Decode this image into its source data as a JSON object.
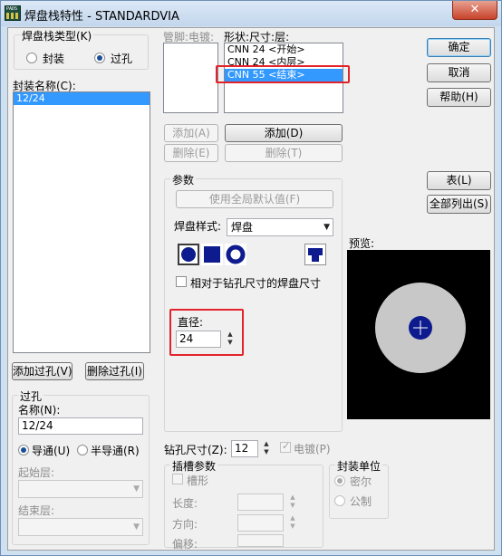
{
  "window": {
    "title": "焊盘栈特性 - STANDARDVIA",
    "close_glyph": "✕"
  },
  "padstack_type": {
    "label": "焊盘栈类型(K)",
    "options": [
      "封装",
      "过孔"
    ],
    "selected": "过孔"
  },
  "decal_name": {
    "label": "封装名称(C):",
    "items": [
      "12/24"
    ],
    "selected": "12/24"
  },
  "pin_electrical": {
    "label": "管脚:电镀:"
  },
  "shape_list": {
    "label": "形状:尺寸:层:",
    "items": [
      "CNN 24 <开始>",
      "CNN 24 <内层>",
      "CNN 55 <结束>"
    ],
    "selected_index": 2
  },
  "buttons": {
    "ok": "确定",
    "cancel": "取消",
    "help": "帮助(H)",
    "add_left": "添加(A)",
    "delete_left": "删除(E)",
    "add_right": "添加(D)",
    "delete_right": "删除(T)",
    "table": "表(L)",
    "list_all": "全部列出(S)",
    "add_via": "添加过孔(V)",
    "delete_via": "删除过孔(I)",
    "use_global_default": "使用全局默认值(F)"
  },
  "params": {
    "title": "参数",
    "pad_style_label": "焊盘样式:",
    "pad_style_value": "焊盘",
    "relative_checkbox": "相对于钻孔尺寸的焊盘尺寸",
    "diameter_label": "直径:",
    "diameter_value": "24"
  },
  "preview": {
    "label": "预览:"
  },
  "via": {
    "title": "过孔",
    "name_label": "名称(N):",
    "name_value": "12/24",
    "through": "导通(U)",
    "partial": "半导通(R)",
    "selected": "导通(U)",
    "start_layer": "起始层:",
    "end_layer": "结束层:"
  },
  "drill": {
    "label": "钻孔尺寸(Z):",
    "value": "12",
    "plated": "电镀(P)",
    "plated_checked": true
  },
  "slot": {
    "title": "插槽参数",
    "slotted": "槽形",
    "length": "长度:",
    "orientation": "方向:",
    "offset": "偏移:"
  },
  "units": {
    "title": "封装单位",
    "mils": "密尔",
    "metric": "公制",
    "selected": "密尔"
  },
  "colors": {
    "highlight": "#e3232b",
    "selection": "#3399ff",
    "pad_blue": "#0d1b8e",
    "preview_bg": "#000000",
    "preview_pad": "#c8c8c8"
  }
}
